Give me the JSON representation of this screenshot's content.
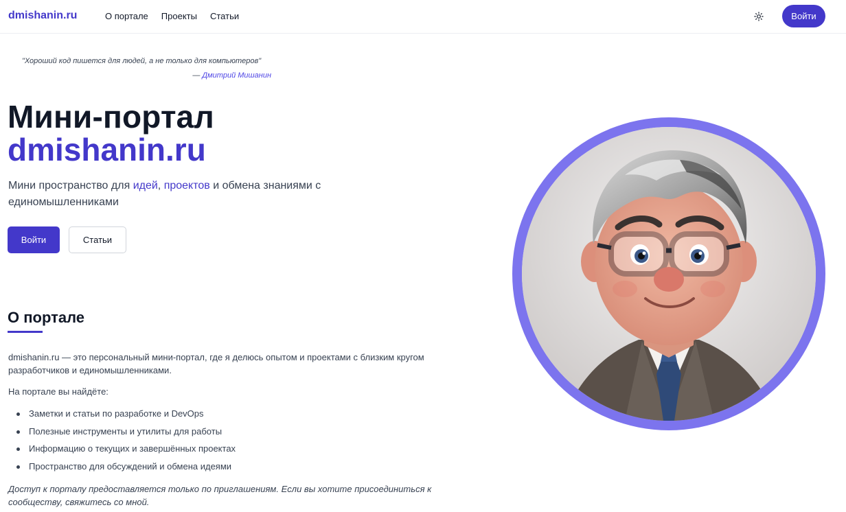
{
  "header": {
    "logo": "dmishanin.ru",
    "nav": [
      "О портале",
      "Проекты",
      "Статьи"
    ],
    "login_label": "Войти",
    "theme_icon": "sun-icon"
  },
  "quote": {
    "text": "\"Хороший код пишется для людей, а не только для компьютеров\"",
    "dash": "— ",
    "author": "Дмитрий Мишанин"
  },
  "hero": {
    "title_line1": "Мини-портал",
    "title_line2": "dmishanin.ru",
    "subtitle_part1": "Мини пространство для ",
    "subtitle_link1": "идей",
    "subtitle_part2": ", ",
    "subtitle_link2": "проектов",
    "subtitle_part3": " и обмена знаниями с единомышленниками",
    "primary_button": "Войти",
    "secondary_button": "Статьи"
  },
  "about": {
    "title": "О портале",
    "paragraph": "dmishanin.ru — это персональный мини-портал, где я делюсь опытом и проектами с близким кругом разработчиков и единомышленниками.",
    "list_intro": "На портале вы найдёте:",
    "items": [
      "Заметки и статьи по разработке и DevOps",
      "Полезные инструменты и утилиты для работы",
      "Информацию о текущих и завершённых проектах",
      "Пространство для обсуждений и обмена идеями"
    ],
    "note": "Доступ к порталу предоставляется только по приглашениям. Если вы хотите присоединиться к сообществу, свяжитесь со мной."
  },
  "colors": {
    "accent": "#4338ca",
    "avatar_ring": "#7c74ee"
  }
}
